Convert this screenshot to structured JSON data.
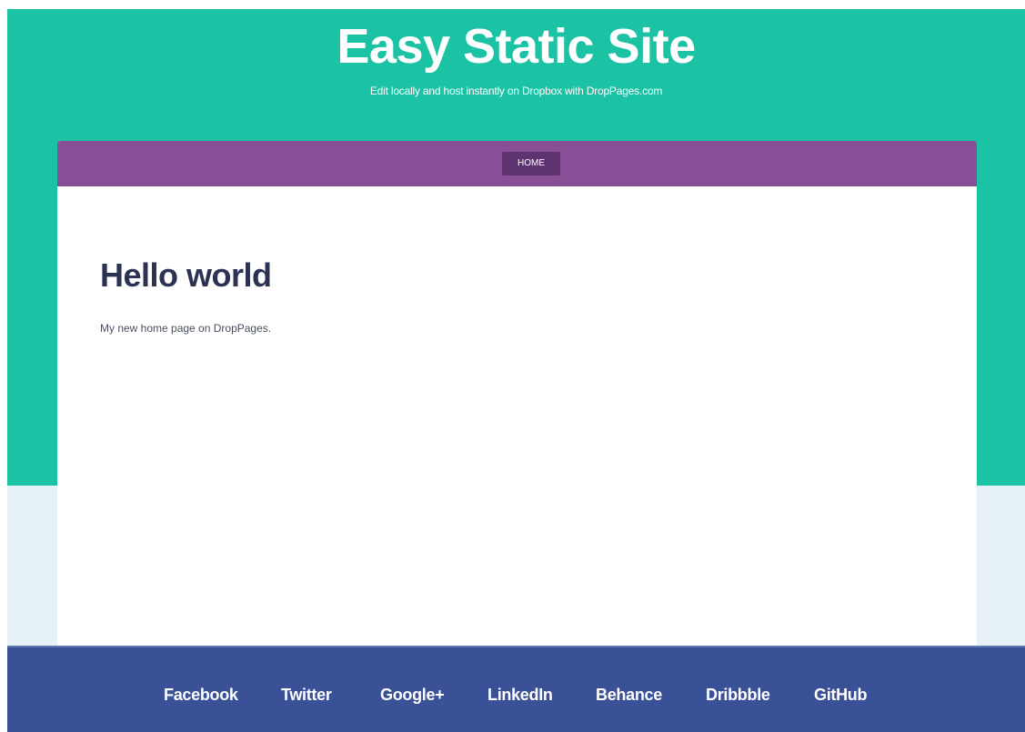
{
  "site": {
    "title": "Easy Static Site",
    "tagline": "Edit locally and host instantly on Dropbox with DropPages.com"
  },
  "nav": {
    "items": [
      {
        "label": "HOME"
      }
    ]
  },
  "main": {
    "heading": "Hello world",
    "body": "My new home page on DropPages."
  },
  "footer": {
    "links": [
      {
        "label": "Facebook"
      },
      {
        "label": "Twitter"
      },
      {
        "label": "Google+"
      },
      {
        "label": "LinkedIn"
      },
      {
        "label": "Behance"
      },
      {
        "label": "Dribbble"
      },
      {
        "label": "GitHub"
      }
    ]
  },
  "colors": {
    "hero_background": "#1bc2a4",
    "page_background": "#e6f1f8",
    "navbar_background": "#894f96",
    "nav_item_active": "#5e3470",
    "footer_background": "#3b5197",
    "heading_text": "#2b3252"
  }
}
